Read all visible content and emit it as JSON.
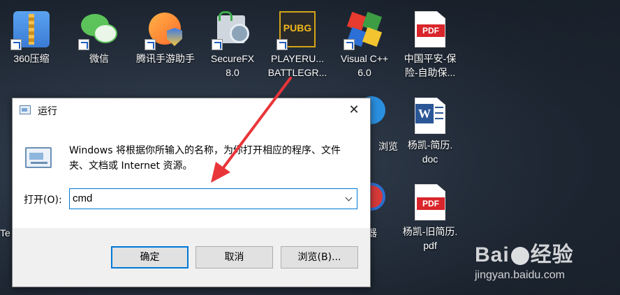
{
  "desktop": {
    "icons": [
      {
        "label": "360压缩",
        "icon": "zip-archive-icon"
      },
      {
        "label": "微信",
        "icon": "wechat-icon"
      },
      {
        "label": "腾讯手游助手",
        "icon": "tencent-game-assistant-icon"
      },
      {
        "label": "SecureFX\n8.0",
        "icon": "securefx-icon"
      },
      {
        "label": "PLAYERU...\nBATTLEGR...",
        "icon": "pubg-icon"
      },
      {
        "label": "Visual C++\n6.0",
        "icon": "visual-cpp-icon"
      },
      {
        "label": "中国平安-保\n险-自助保...",
        "icon": "pdf-file-icon"
      },
      {
        "label": "杨凯-简历.\ndoc",
        "icon": "word-doc-icon"
      },
      {
        "label": "杨凯-旧简历.\npdf",
        "icon": "pdf-file-icon"
      }
    ],
    "partial_labels": [
      "浏览",
      "器",
      "Te"
    ],
    "pubg_text": "PUBG",
    "pdf_badge": "PDF",
    "word_badge": "W"
  },
  "dialog": {
    "title": "运行",
    "close": "✕",
    "description": "Windows 将根据你所输入的名称，为你打开相应的程序、文件夹、文档或 Internet 资源。",
    "open_label": "打开(O):",
    "input_value": "cmd",
    "buttons": {
      "ok": "确定",
      "cancel": "取消",
      "browse": "浏览(B)..."
    }
  },
  "watermark": {
    "logo_left": "Bai",
    "logo_right": "经验",
    "url": "jingyan.baidu.com"
  },
  "colors": {
    "accent": "#0078d7",
    "arrow": "#e8353a"
  }
}
